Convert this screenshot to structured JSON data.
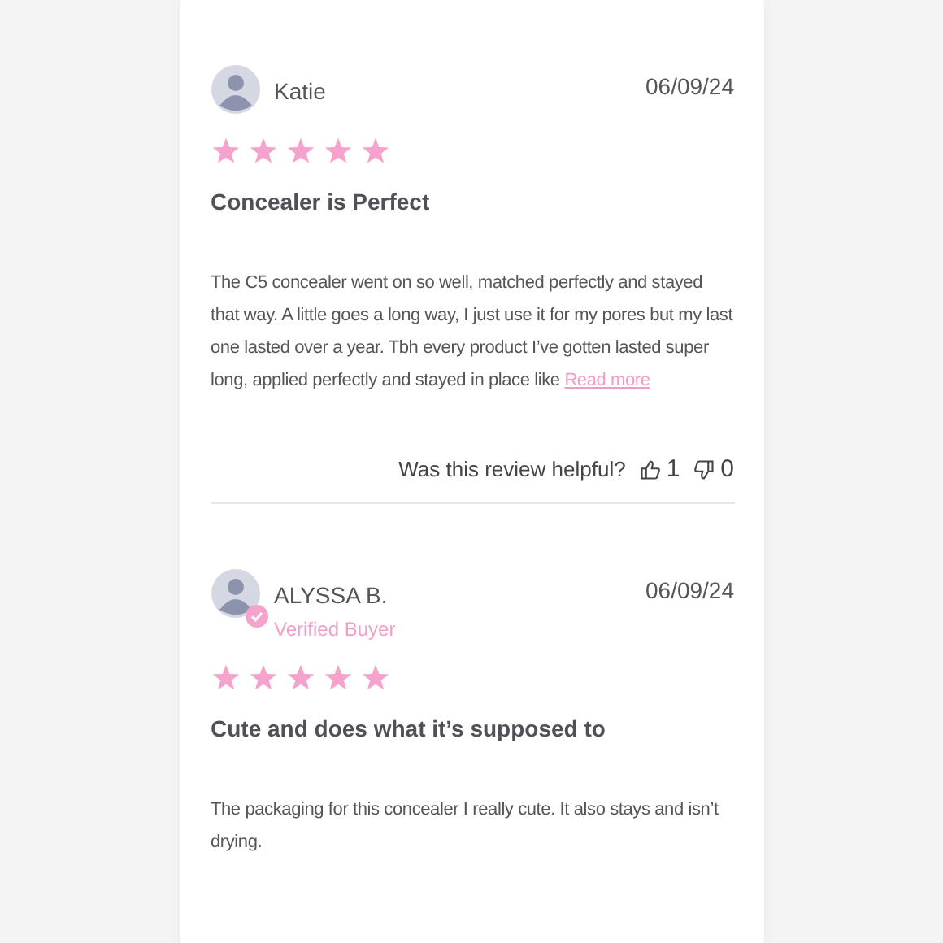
{
  "reviews": [
    {
      "name": "Katie",
      "verified": false,
      "date": "06/09/24",
      "stars": 5,
      "title": "Concealer is Perfect",
      "body": "The C5 concealer went on so well, matched perfectly and stayed that way. A little goes a long way, I just use it for my pores but my last one lasted over a year. Tbh every product I’ve gotten lasted super long, applied perfectly and stayed in place like",
      "read_more": "Read more",
      "helpful": {
        "question": "Was this review helpful?",
        "up": "1",
        "down": "0"
      }
    },
    {
      "name": "ALYSSA B.",
      "verified": true,
      "verified_label": "Verified Buyer",
      "date": "06/09/24",
      "stars": 5,
      "title": "Cute and does what it’s supposed to",
      "body": "The packaging for this concealer I really cute. It also stays and isn’t drying."
    }
  ]
}
